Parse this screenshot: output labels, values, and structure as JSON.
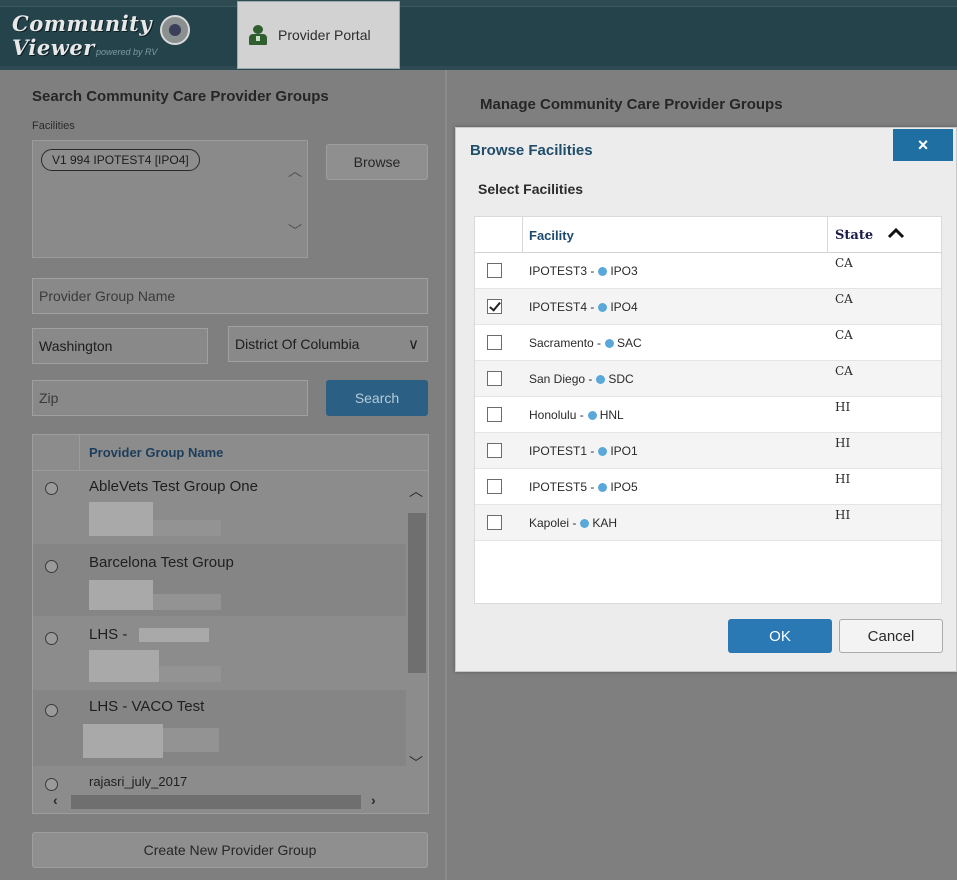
{
  "header": {
    "logo_line1": "Community",
    "logo_line2": "Viewer",
    "logo_powered": "powered by RV",
    "tab_label": "Provider Portal"
  },
  "left": {
    "title": "Search Community Care Provider Groups",
    "facilities_label": "Facilities",
    "selected_facility": "V1 994 IPOTEST4 [IPO4]",
    "browse_label": "Browse",
    "name_placeholder": "Provider Group Name",
    "city_value": "Washington",
    "state_value": "District Of Columbia",
    "zip_placeholder": "Zip",
    "search_label": "Search",
    "grid_header": "Provider Group Name",
    "groups": [
      {
        "name": "AbleVets Test Group One"
      },
      {
        "name": "Barcelona Test Group"
      },
      {
        "name": "LHS - "
      },
      {
        "name": "LHS - VACO Test"
      },
      {
        "name": "rajasri_july_2017"
      }
    ],
    "create_label": "Create New Provider Group"
  },
  "right": {
    "title": "Manage Community Care Provider Groups"
  },
  "modal": {
    "title": "Browse Facilities",
    "close_label": "×",
    "subtitle": "Select Facilities",
    "col_facility": "Facility",
    "col_state": "State",
    "rows": [
      {
        "name": "IPOTEST3 - ",
        "code": "IPO3",
        "state": "CA",
        "checked": false
      },
      {
        "name": "IPOTEST4 - ",
        "code": "IPO4",
        "state": "CA",
        "checked": true
      },
      {
        "name": "Sacramento - ",
        "code": "SAC",
        "state": "CA",
        "checked": false
      },
      {
        "name": "San Diego - ",
        "code": "SDC",
        "state": "CA",
        "checked": false
      },
      {
        "name": "Honolulu - ",
        "code": "HNL",
        "state": "HI",
        "checked": false
      },
      {
        "name": "IPOTEST1 - ",
        "code": "IPO1",
        "state": "HI",
        "checked": false
      },
      {
        "name": "IPOTEST5 - ",
        "code": "IPO5",
        "state": "HI",
        "checked": false
      },
      {
        "name": "Kapolei - ",
        "code": "KAH",
        "state": "HI",
        "checked": false
      }
    ],
    "ok_label": "OK",
    "cancel_label": "Cancel"
  },
  "colors": {
    "header_bg": "#24434b",
    "accent_blue": "#2a78b4",
    "dot_blue": "#5aa8da",
    "title_blue": "#1f4d6a"
  }
}
